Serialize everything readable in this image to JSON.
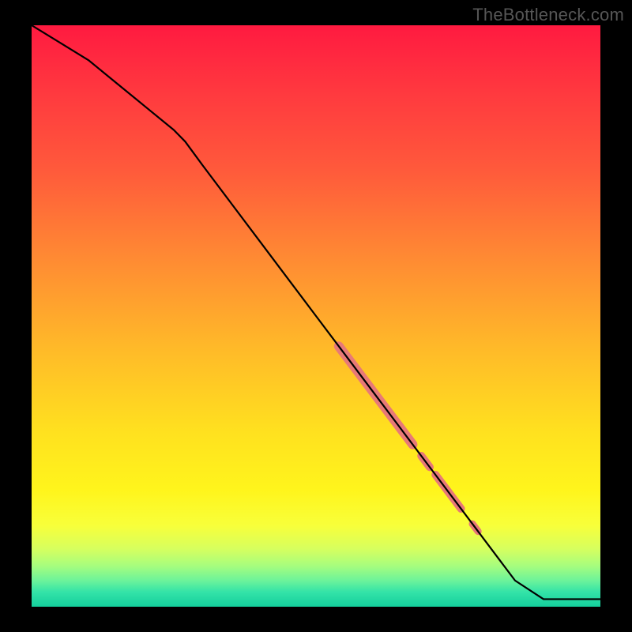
{
  "watermark": "TheBottleneck.com",
  "chart_data": {
    "type": "line",
    "title": "",
    "xlabel": "",
    "ylabel": "",
    "xlim": [
      0,
      100
    ],
    "ylim": [
      0,
      100
    ],
    "series": [
      {
        "name": "main-curve",
        "x": [
          0,
          5,
          10,
          15,
          20,
          25,
          27,
          30,
          35,
          40,
          45,
          50,
          55,
          60,
          65,
          70,
          75,
          80,
          85,
          90,
          92,
          95,
          100
        ],
        "y": [
          100,
          97,
          94,
          90,
          86,
          82,
          80,
          76,
          69.5,
          63,
          56.5,
          50,
          43.5,
          37,
          30.5,
          24,
          17.5,
          11,
          4.5,
          1.3,
          1.3,
          1.3,
          1.3
        ]
      }
    ],
    "highlights": {
      "name": "highlighted-range",
      "color": "#e77977",
      "segments": [
        {
          "x0": 54,
          "y0": 44.8,
          "x1": 67,
          "y1": 27.9,
          "width": 12
        },
        {
          "x0": 68.5,
          "y0": 25.95,
          "x1": 70,
          "y1": 24,
          "width": 10
        },
        {
          "x0": 71,
          "y0": 22.7,
          "x1": 75.5,
          "y1": 16.85,
          "width": 10
        },
        {
          "x0": 77.5,
          "y0": 14.25,
          "x1": 78.5,
          "y1": 12.95,
          "width": 9
        }
      ]
    },
    "background_gradient": {
      "stops": [
        {
          "pos": 0.0,
          "color": "#ff1a40"
        },
        {
          "pos": 0.12,
          "color": "#ff3a3f"
        },
        {
          "pos": 0.25,
          "color": "#ff5a3b"
        },
        {
          "pos": 0.4,
          "color": "#ff8a33"
        },
        {
          "pos": 0.55,
          "color": "#ffb829"
        },
        {
          "pos": 0.7,
          "color": "#ffe11f"
        },
        {
          "pos": 0.8,
          "color": "#fff51c"
        },
        {
          "pos": 0.86,
          "color": "#f8ff3a"
        },
        {
          "pos": 0.9,
          "color": "#d7ff5e"
        },
        {
          "pos": 0.93,
          "color": "#a6fd7e"
        },
        {
          "pos": 0.955,
          "color": "#6cf39a"
        },
        {
          "pos": 0.975,
          "color": "#33e3a8"
        },
        {
          "pos": 1.0,
          "color": "#14cf9c"
        }
      ]
    }
  }
}
